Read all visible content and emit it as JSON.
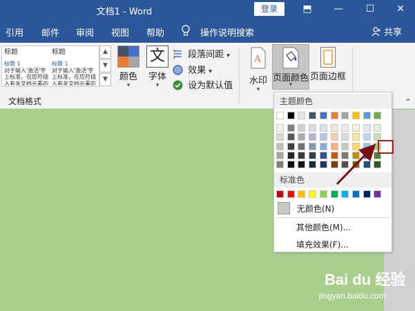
{
  "titlebar": {
    "title": "文档1  -  Word",
    "login": "登录",
    "buttons": [
      "⬒",
      "—",
      "☐",
      "✕"
    ]
  },
  "tabs": [
    "引用",
    "邮件",
    "审阅",
    "视图",
    "帮助",
    "操作说明搜索"
  ],
  "share": "共享",
  "ribbon": {
    "style_gallery": [
      {
        "heading": "标题",
        "sub": "标题 1",
        "body": "对于输入'激活'字上标准，在应符插入有关文档元素的内容开始列表样式"
      },
      {
        "heading": "标题",
        "sub": "标题 1",
        "body": "对于输入'激活'字上标准，在应符插入有关文档元素的内容开始列表样式"
      }
    ],
    "colors_label": "颜色",
    "font_label": "字体",
    "font_glyph": "文",
    "paragraph_spacing": "段落间距",
    "effects": "效果",
    "set_default": "设为默认值",
    "group_label": "文档格式",
    "watermark": "水印",
    "page_color": "页面颜色",
    "page_border": "页面边框",
    "theme_colors_hex": [
      "#4472c4",
      "#ed7d31",
      "#a5a5a5",
      "#ffc000"
    ]
  },
  "dropdown": {
    "theme_header": "主题颜色",
    "standard_header": "标准色",
    "no_color": "无颜色(N)",
    "more_colors": "其他颜色(M)...",
    "fill_effects": "填充效果(F)...",
    "theme_top": [
      "#ffffff",
      "#000000",
      "#e7e6e6",
      "#44546a",
      "#4472c4",
      "#ed7d31",
      "#a5a5a5",
      "#ffc000",
      "#5b9bd5",
      "#70ad47"
    ],
    "theme_shades": [
      [
        "#f2f2f2",
        "#d9d9d9",
        "#bfbfbf",
        "#a6a6a6",
        "#7f7f7f"
      ],
      [
        "#7f7f7f",
        "#595959",
        "#404040",
        "#262626",
        "#0d0d0d"
      ],
      [
        "#d0cece",
        "#aeabab",
        "#757171",
        "#3a3838",
        "#171616"
      ],
      [
        "#d6dce4",
        "#adb9ca",
        "#8496b0",
        "#333f4f",
        "#222a35"
      ],
      [
        "#d9e2f3",
        "#b4c6e7",
        "#8eaadb",
        "#2f5496",
        "#1f3864"
      ],
      [
        "#fbe5d5",
        "#f7cbac",
        "#f4b183",
        "#c55a11",
        "#833c0b"
      ],
      [
        "#ededed",
        "#dbdbdb",
        "#c9c9c9",
        "#7b7b7b",
        "#525252"
      ],
      [
        "#fff2cc",
        "#fee599",
        "#ffd965",
        "#bf9000",
        "#7f6000"
      ],
      [
        "#deebf6",
        "#bdd7ee",
        "#9dc3e6",
        "#2e75b5",
        "#1e4e79"
      ],
      [
        "#e2efd9",
        "#c5e0b3",
        "#a8d08d",
        "#548235",
        "#375623"
      ]
    ],
    "standard": [
      "#c00000",
      "#ff0000",
      "#ffc000",
      "#ffff00",
      "#92d050",
      "#00b050",
      "#00b0f0",
      "#0070c0",
      "#002060",
      "#7030a0"
    ]
  },
  "watermark_text": {
    "brand": "Bai du 经验",
    "url": "jingyan.baidu.com"
  }
}
